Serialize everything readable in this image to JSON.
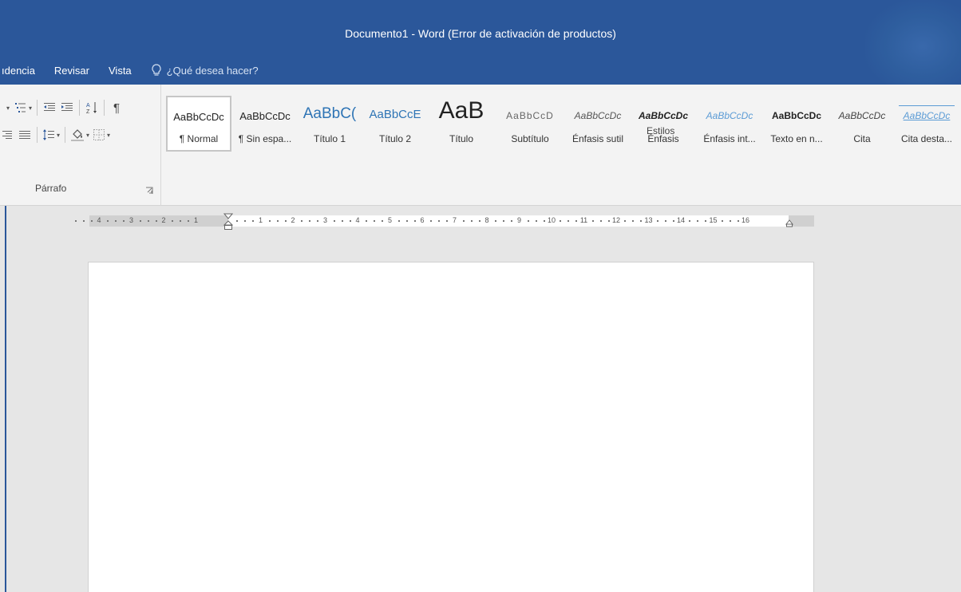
{
  "window": {
    "title": "Documento1 - Word (Error de activación de productos)"
  },
  "tabs": [
    {
      "label": "ıdencia"
    },
    {
      "label": "Revisar"
    },
    {
      "label": "Vista"
    }
  ],
  "tell_me": {
    "placeholder": "¿Qué desea hacer?"
  },
  "groups": {
    "paragraph": "Párrafo",
    "styles": "Estilos"
  },
  "styles": [
    {
      "sample": "AaBbCcDc",
      "name": "¶ Normal",
      "selected": true
    },
    {
      "sample": "AaBbCcDc",
      "name": "¶ Sin espa..."
    },
    {
      "sample": "AaBbC(",
      "name": "Título 1"
    },
    {
      "sample": "AaBbCcE",
      "name": "Título 2"
    },
    {
      "sample": "AaB",
      "name": "Título"
    },
    {
      "sample": "AaBbCcD",
      "name": "Subtítulo"
    },
    {
      "sample": "AaBbCcDc",
      "name": "Énfasis sutil"
    },
    {
      "sample": "AaBbCcDc",
      "name": "Énfasis"
    },
    {
      "sample": "AaBbCcDc",
      "name": "Énfasis int..."
    },
    {
      "sample": "AaBbCcDc",
      "name": "Texto en n..."
    },
    {
      "sample": "AaBbCcDc",
      "name": "Cita"
    },
    {
      "sample": "AaBbCcDc",
      "name": "Cita desta..."
    }
  ],
  "ruler": {
    "numbers": [
      "4",
      "3",
      "2",
      "1",
      "1",
      "2",
      "3",
      "4",
      "5",
      "6",
      "7",
      "8",
      "9",
      "10",
      "11",
      "12",
      "13",
      "14",
      "15",
      "16"
    ]
  },
  "colors": {
    "brand": "#2b579a",
    "ribbon": "#f3f3f3",
    "canvas": "#e6e6e6"
  }
}
